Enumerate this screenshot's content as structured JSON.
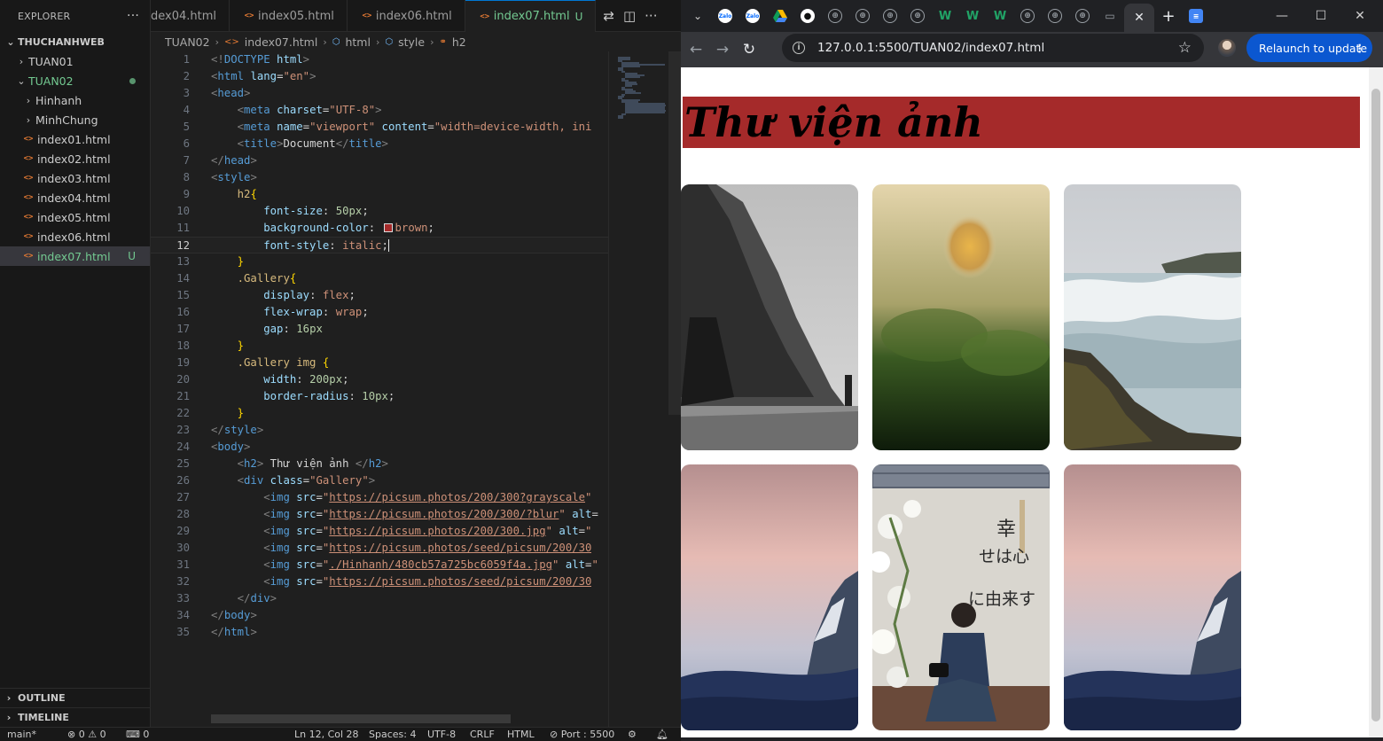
{
  "vscode": {
    "explorer": {
      "title": "EXPLORER",
      "more": "···",
      "workspace": "THUCHANHWEB",
      "items": [
        {
          "label": "TUAN01",
          "kind": "folder",
          "expanded": false
        },
        {
          "label": "TUAN02",
          "kind": "folder",
          "expanded": true
        },
        {
          "label": "Hinhanh",
          "kind": "folder",
          "expanded": false
        },
        {
          "label": "MinhChung",
          "kind": "folder",
          "expanded": false
        },
        {
          "label": "index01.html",
          "kind": "file"
        },
        {
          "label": "index02.html",
          "kind": "file"
        },
        {
          "label": "index03.html",
          "kind": "file"
        },
        {
          "label": "index04.html",
          "kind": "file"
        },
        {
          "label": "index05.html",
          "kind": "file"
        },
        {
          "label": "index06.html",
          "kind": "file"
        },
        {
          "label": "index07.html",
          "kind": "file",
          "selected": true,
          "badge": "U"
        }
      ],
      "outline": "OUTLINE",
      "timeline": "TIMELINE"
    },
    "tabs": [
      {
        "label": "dex04.html",
        "active": false
      },
      {
        "label": "index05.html",
        "active": false
      },
      {
        "label": "index06.html",
        "active": false
      },
      {
        "label": "index07.html",
        "active": true,
        "badge": "U"
      }
    ],
    "breadcrumb": [
      "TUAN02",
      "index07.html",
      "html",
      "style",
      "h2"
    ],
    "current_line": 12,
    "code": [
      "<!DOCTYPE html>",
      "<html lang=\"en\">",
      "<head>",
      "    <meta charset=\"UTF-8\">",
      "    <meta name=\"viewport\" content=\"width=device-width, ini",
      "    <title>Document</title>",
      "</head>",
      "<style>",
      "    h2{",
      "        font-size: 50px;",
      "        background-color: brown;",
      "        font-style: italic;",
      "    }",
      "    .Gallery{",
      "        display: flex;",
      "        flex-wrap: wrap;",
      "        gap: 16px",
      "    }",
      "    .Gallery img {",
      "        width: 200px;",
      "        border-radius: 10px;",
      "    }",
      "</style>",
      "<body>",
      "    <h2> Thư viện ảnh </h2>",
      "    <div class=\"Gallery\">",
      "        <img src=\"https://picsum.photos/200/300?grayscale\"",
      "        <img src=\"https://picsum.photos/200/300/?blur\" alt=",
      "        <img src=\"https://picsum.photos/200/300.jpg\" alt=\"",
      "        <img src=\"https://picsum.photos/seed/picsum/200/30",
      "        <img src=\"./Hinhanh/480cb57a725bc6059f4a.jpg\" alt=\"",
      "        <img src=\"https://picsum.photos/seed/picsum/200/30",
      "    </div>",
      "</body>",
      "</html>"
    ],
    "status": {
      "branch": "main*",
      "problems": "⊗ 0 ⚠ 0",
      "ports": "⌨ 0",
      "position": "Ln 12, Col 28",
      "spaces": "Spaces: 4",
      "encoding": "UTF-8",
      "eol": "CRLF",
      "language": "HTML",
      "port": "⊘ Port : 5500"
    }
  },
  "chrome": {
    "url": "127.0.0.1:5500/TUAN02/index07.html",
    "relaunch_label": "Relaunch to update",
    "tabs": [
      {
        "icon": "zalo-icon",
        "label": "Zalo",
        "color": "#0068ff"
      },
      {
        "icon": "zalo-icon",
        "label": "Zalo",
        "color": "#0068ff"
      },
      {
        "icon": "google-drive-icon",
        "label": "",
        "color": "#f4b400"
      },
      {
        "icon": "github-icon",
        "label": "",
        "color": "#ffffff"
      },
      {
        "icon": "globe-icon",
        "label": "",
        "color": "#9aa0a6"
      },
      {
        "icon": "globe-icon",
        "label": "",
        "color": "#9aa0a6"
      },
      {
        "icon": "globe-icon",
        "label": "",
        "color": "#9aa0a6"
      },
      {
        "icon": "globe-icon",
        "label": "",
        "color": "#9aa0a6"
      },
      {
        "icon": "w-icon",
        "label": "W",
        "color": "#21a366"
      },
      {
        "icon": "w-icon",
        "label": "W",
        "color": "#21a366"
      },
      {
        "icon": "w-icon",
        "label": "W",
        "color": "#21a366"
      },
      {
        "icon": "globe-icon",
        "label": "",
        "color": "#9aa0a6"
      },
      {
        "icon": "globe-icon",
        "label": "",
        "color": "#9aa0a6"
      },
      {
        "icon": "globe-icon",
        "label": "",
        "color": "#9aa0a6"
      },
      {
        "icon": "screen-icon",
        "label": "",
        "color": "#9aa0a6"
      }
    ],
    "page": {
      "heading": "Thư viện ảnh",
      "heading_bg": "#a52a2a",
      "gallery": [
        {
          "name": "grayscale-cliff-photo",
          "desc": "grayscale"
        },
        {
          "name": "blurred-balloon-photo",
          "desc": "blur"
        },
        {
          "name": "waterfall-photo",
          "desc": "waterfall"
        },
        {
          "name": "mountain-sunset-photo",
          "desc": "sunset"
        },
        {
          "name": "person-photographer-photo",
          "desc": "photographer",
          "kanji": "幸せは心に由来す"
        },
        {
          "name": "mountain-sunset-photo-2",
          "desc": "sunset"
        }
      ]
    }
  }
}
